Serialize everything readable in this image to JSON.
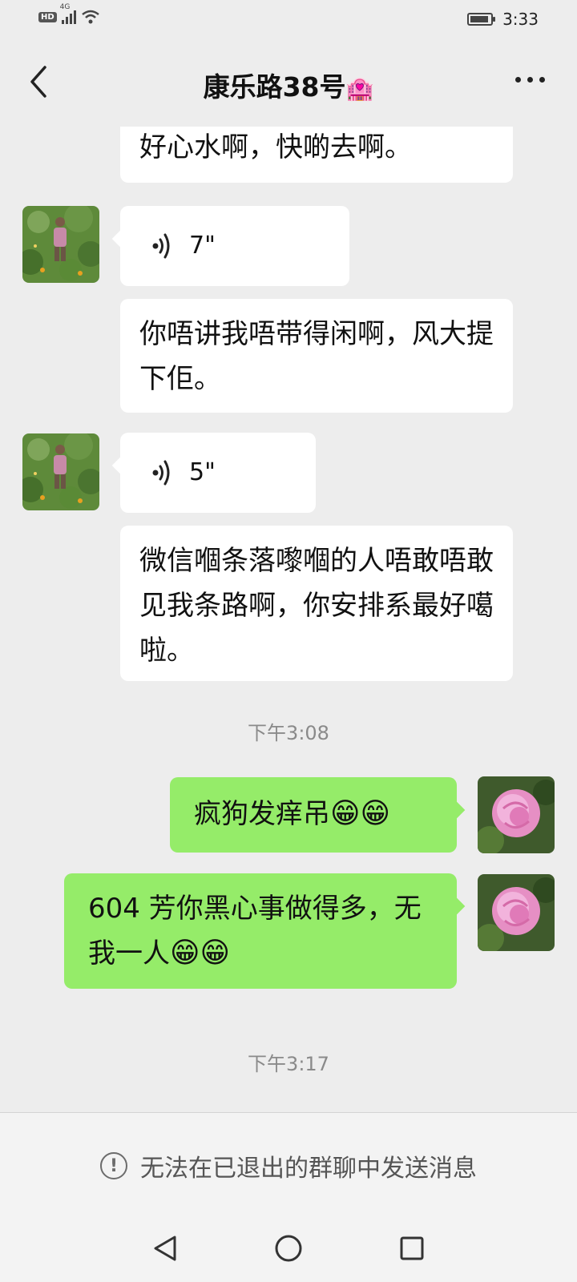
{
  "status_bar": {
    "hd": "HD",
    "network": "4G",
    "battery_level": 0.9,
    "time": "3:33"
  },
  "header": {
    "title": "康乐路38号",
    "title_emoji": "🏩"
  },
  "messages": {
    "m1": {
      "text": "好心水啊，快啲去啊。"
    },
    "m2": {
      "duration": "7\""
    },
    "m3": {
      "text": "你唔讲我唔带得闲啊，风大提下佢。"
    },
    "m4": {
      "duration": "5\""
    },
    "m5": {
      "text": "微信嗰条落嚟嗰的人唔敢唔敢见我条路啊，你安排系最好噶啦。"
    },
    "m6": {
      "text": "疯狗发痒吊",
      "emoji": "😁😁"
    },
    "m7": {
      "text": "604 芳你黑心事做得多，无我一人",
      "emoji": "😁😁"
    }
  },
  "timestamps": {
    "t1": "下午3:08",
    "t2": "下午3:17"
  },
  "footer": {
    "notice": "无法在已退出的群聊中发送消息",
    "icon": "exclamation-circle-icon"
  },
  "colors": {
    "background": "#ededed",
    "self_bubble": "#95ec69",
    "other_bubble": "#ffffff"
  }
}
